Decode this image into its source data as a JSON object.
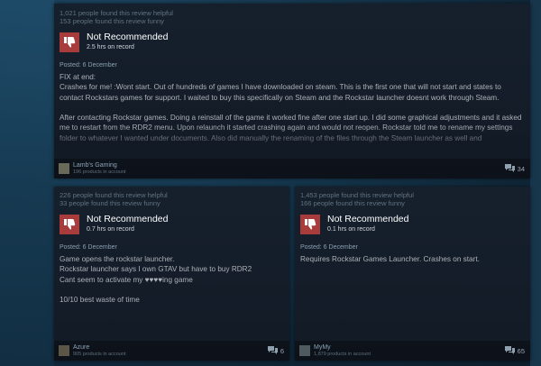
{
  "reviews": [
    {
      "helpful": "1,021 people found this review helpful",
      "funny": "153 people found this review funny",
      "verdict": "Not Recommended",
      "hours": "2.5 hrs on record",
      "posted": "Posted: 6 December",
      "body": "FIX at end:\nCrashes for me! :Wont start. Out of hundreds of games I have downloaded on steam. This is the first one that will not start and states to contact Rockstars games for support. I waited to buy this specifically on Steam and the Rockstar launcher doesnt work through Steam.\n\nAfter contacting Rockstar games. Doing a reinstall of the game it worked fine after one start up. I did some graphical adjustments and it asked me to restart from the RDR2 menu. Upon relaunch it started crashing again and would not reopen. Rockstar told me to rename my settings folder to whatever I wanted under documents. Also did manually the renaming of the files through the Steam launcher as well and",
      "author": "Lamb's Gaming",
      "products": "196 products in account",
      "comments": "34",
      "avatar_color": "#6a6a58"
    },
    {
      "helpful": "226 people found this review helpful",
      "funny": "33 people found this review funny",
      "verdict": "Not Recommended",
      "hours": "0.7 hrs on record",
      "posted": "Posted: 6 December",
      "body": "Game opens the rockstar launcher.\nRockstar launcher says I own GTAV but have to buy RDR2\nCant seem to activate my ♥♥♥♥ing game\n\n10/10 best waste of time",
      "author": "Azure",
      "products": "905 products in account",
      "comments": "6",
      "avatar_color": "#5c5646"
    },
    {
      "helpful": "1,453 people found this review helpful",
      "funny": "166 people found this review funny",
      "verdict": "Not Recommended",
      "hours": "0.1 hrs on record",
      "posted": "Posted: 6 December",
      "body": "Requires Rockstar Games Launcher. Crashes on start.",
      "author": "MyMy",
      "products": "1,879 products in account",
      "comments": "65",
      "avatar_color": "#4e5a5e"
    }
  ],
  "colors": {
    "thumb_bg": "#a83b3b",
    "card_bg": "#16202d",
    "page_bg": "#1b3a52"
  },
  "icons": {
    "verdict": "thumbs-down-icon",
    "comments": "comment-bubble-icon"
  }
}
